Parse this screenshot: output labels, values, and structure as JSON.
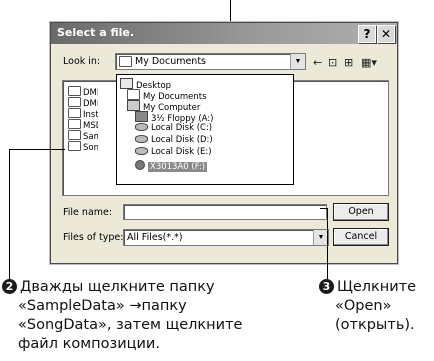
{
  "dialog": {
    "title": "Select a file.",
    "help_button": "?",
    "close_button": "✕",
    "look_in_label": "Look in:",
    "look_in_value": "My Documents",
    "file_name_label": "File name:",
    "file_name_value": "",
    "files_of_type_label": "Files of type:",
    "files_of_type_value": "All Files(*.*)",
    "open_button": "Open",
    "cancel_button": "Cancel",
    "files": [
      "DMN_",
      "DMN_",
      "Install",
      "MSD_",
      "Sampl",
      "SongE"
    ],
    "dropdown_items": [
      {
        "label": "Desktop",
        "icon": "desktop-icon"
      },
      {
        "label": "My Documents",
        "icon": "folder-icon"
      },
      {
        "label": "My Computer",
        "icon": "computer-icon"
      },
      {
        "label": "3½ Floppy (A:)",
        "icon": "floppy-icon"
      },
      {
        "label": "Local Disk (C:)",
        "icon": "disk-icon"
      },
      {
        "label": "Local Disk (D:)",
        "icon": "disk-icon"
      },
      {
        "label": "Local Disk (E:)",
        "icon": "disk-icon"
      },
      {
        "label": "X3013A0 (F:)",
        "icon": "cd-icon"
      }
    ]
  },
  "callouts": {
    "step2": {
      "number": "2",
      "lines": [
        "Дважды щелкните папку",
        "«SampleData» →папку",
        "«SongData», затем щелкните",
        "файл композиции."
      ]
    },
    "step3": {
      "number": "3",
      "lines": [
        "Щелкните",
        "«Open»",
        "(открыть)."
      ]
    }
  }
}
